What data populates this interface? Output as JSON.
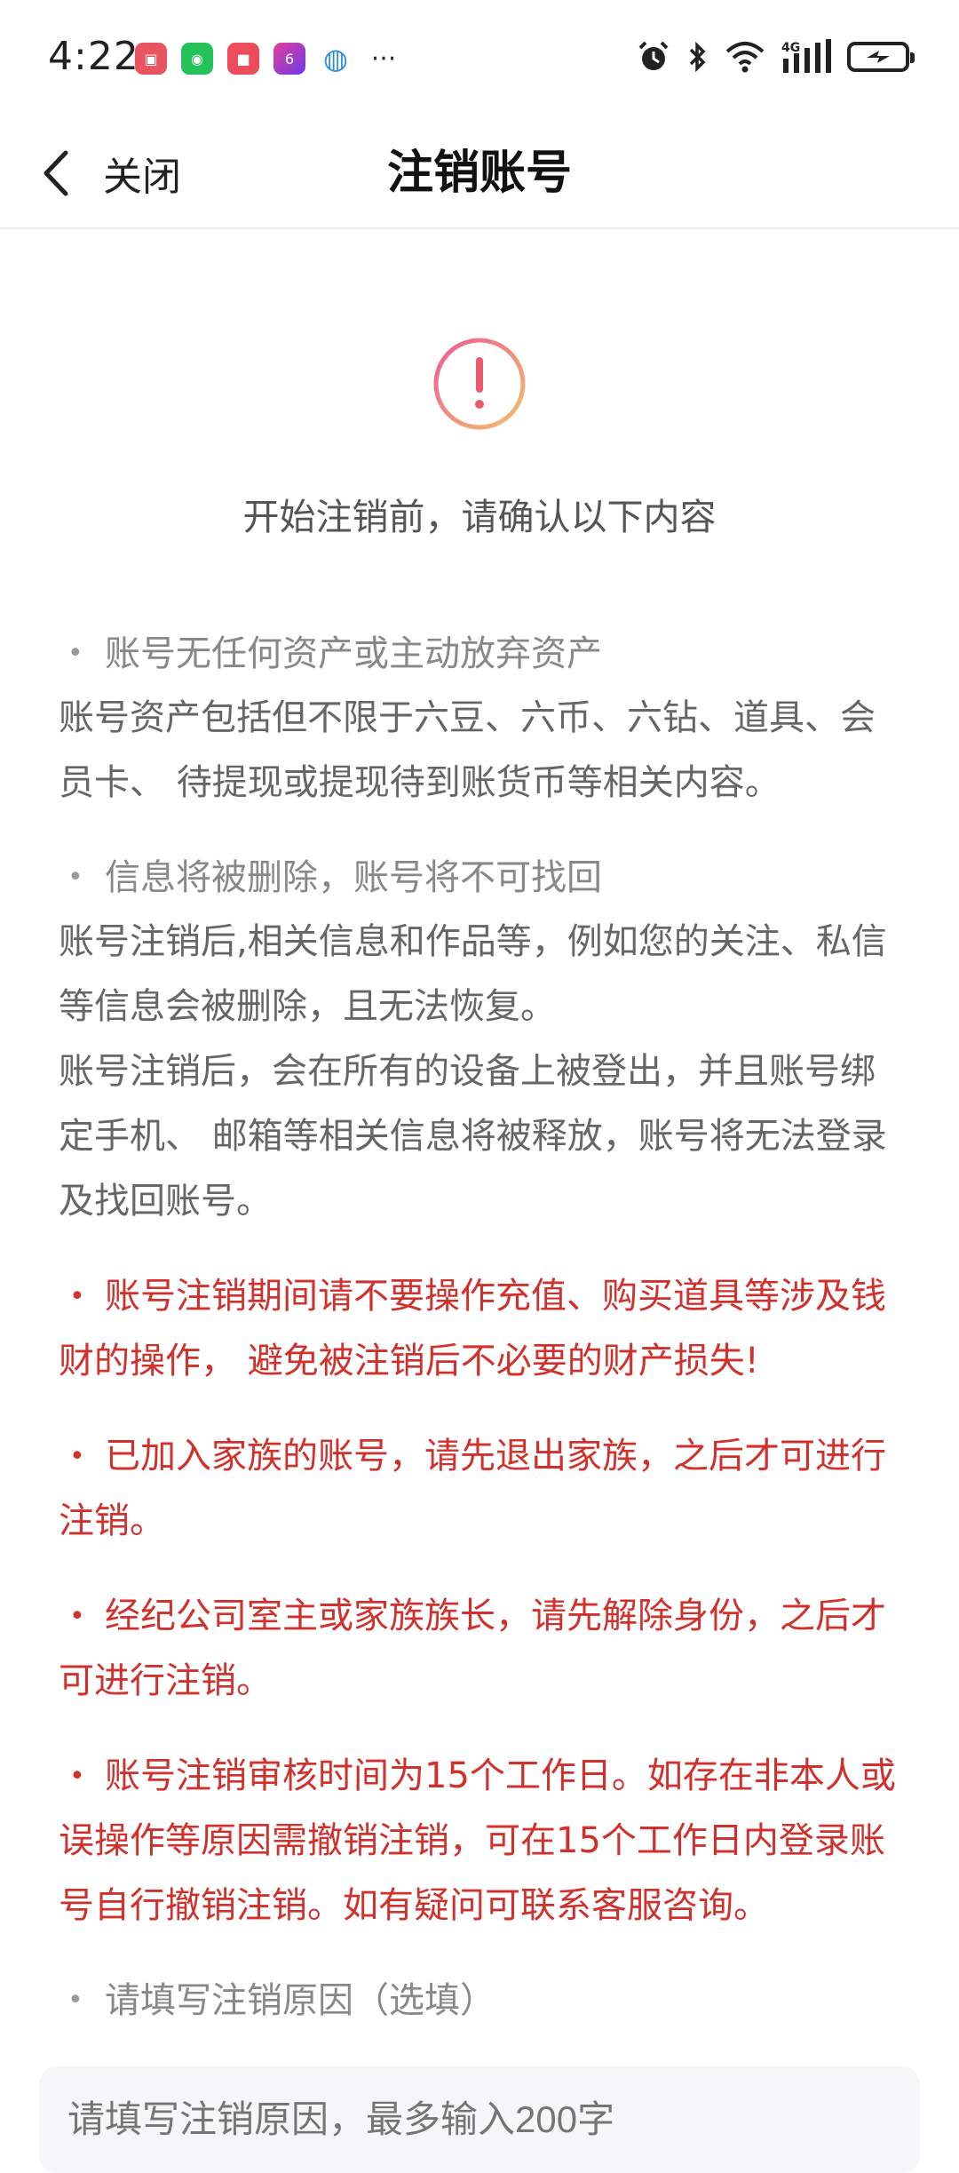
{
  "status_bar": {
    "time": "4:22",
    "notifications": [
      {
        "name": "huawei-app-icon",
        "glyph": "▣"
      },
      {
        "name": "wechat-icon",
        "glyph": "◉"
      },
      {
        "name": "red-app-icon",
        "glyph": "■"
      },
      {
        "name": "video-app-icon",
        "glyph": "6"
      },
      {
        "name": "browser-icon",
        "glyph": "◍"
      }
    ],
    "more": "···",
    "network": "4G"
  },
  "nav": {
    "back_label": "关闭",
    "title": "注销账号"
  },
  "intro": "开始注销前，请确认以下内容",
  "sections": {
    "assets": {
      "heading": "账号无任何资产或主动放弃资产",
      "body": "账号资产包括但不限于六豆、六币、六钻、道具、会员卡、 待提现或提现待到账货币等相关内容。"
    },
    "info": {
      "heading": "信息将被删除，账号将不可找回",
      "body1": "账号注销后,相关信息和作品等，例如您的关注、私信等信息会被删除，且无法恢复。",
      "body2": "账号注销后，会在所有的设备上被登出，并且账号绑定手机、 邮箱等相关信息将被释放，账号将无法登录及找回账号。"
    },
    "warnings": [
      "账号注销期间请不要操作充值、购买道具等涉及钱财的操作， 避免被注销后不必要的财产损失!",
      "已加入家族的账号，请先退出家族，之后才可进行注销。",
      "经纪公司室主或家族族长，请先解除身份，之后才可进行注销。",
      "账号注销审核时间为15个工作日。如存在非本人或误操作等原因需撤销注销，可在15个工作日内登录账号自行撤销注销。如有疑问可联系客服咨询。"
    ],
    "reason": {
      "heading": "请填写注销原因（选填）",
      "placeholder": "请填写注销原因，最多输入200字"
    }
  },
  "colors": {
    "warning_red": "#d0312d",
    "icon_gradient_start": "#f05a7e",
    "icon_gradient_end": "#f4b36a"
  }
}
